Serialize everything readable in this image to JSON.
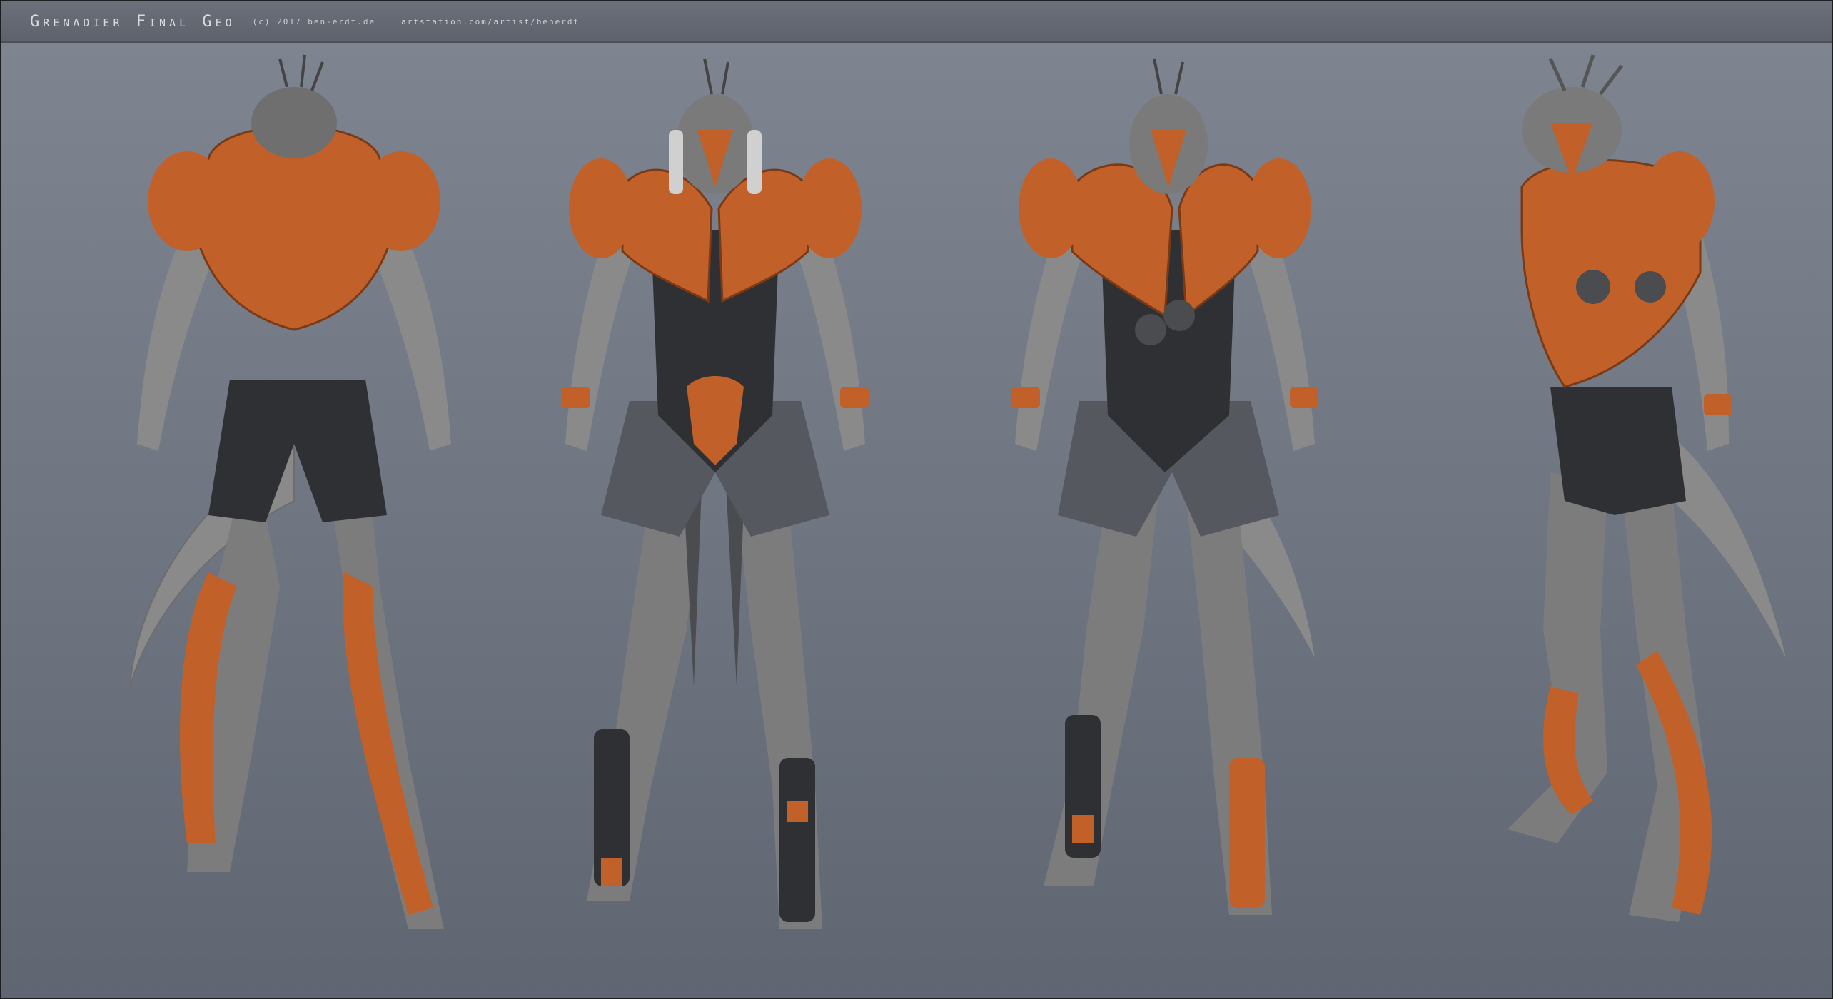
{
  "header": {
    "title": "Grenadier Final Geo",
    "credit": "(c) 2017 ben-erdt.de",
    "site": "artstation.com/artist/benerdt"
  },
  "figures": [
    {
      "icon": "character-back-view",
      "view": "back"
    },
    {
      "icon": "character-front-view",
      "view": "front"
    },
    {
      "icon": "character-three-quarter-view",
      "view": "three-quarter"
    },
    {
      "icon": "character-side-view",
      "view": "side"
    }
  ],
  "colors": {
    "background_top": "#7f8591",
    "background_bottom": "#5f6672",
    "armor_orange": "#c2602a",
    "skin_grey": "#8a8a8a",
    "dark_suit": "#2e3034"
  }
}
